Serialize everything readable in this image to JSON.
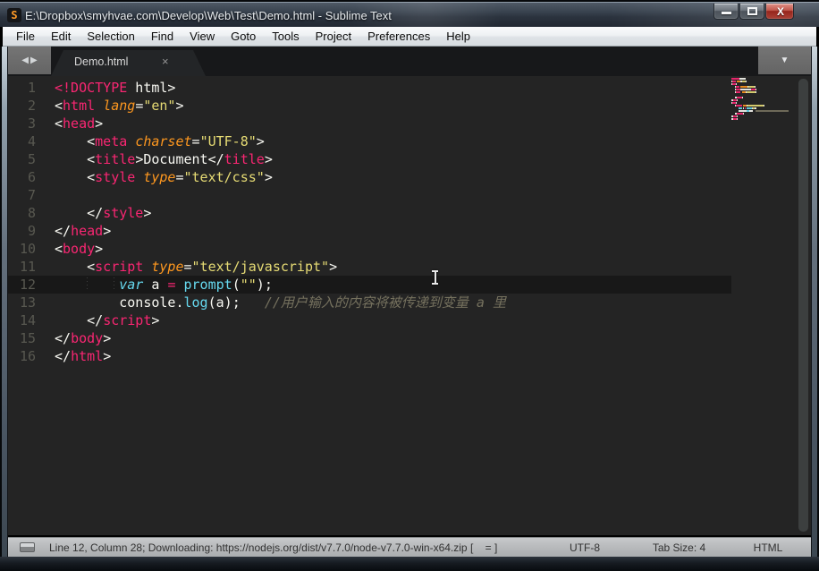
{
  "window": {
    "title": "E:\\Dropbox\\smyhvae.com\\Develop\\Web\\Test\\Demo.html - Sublime Text",
    "logo_letter": "S",
    "controls": {
      "minimize": "minimize",
      "maximize": "maximize",
      "close": "x"
    }
  },
  "menu": {
    "items": [
      "File",
      "Edit",
      "Selection",
      "Find",
      "View",
      "Goto",
      "Tools",
      "Project",
      "Preferences",
      "Help"
    ]
  },
  "tabbar": {
    "nav_left": "◀",
    "nav_right": "▶",
    "tab_label": "Demo.html",
    "close_glyph": "×",
    "overflow_glyph": "▼"
  },
  "editor": {
    "current_line": 12,
    "colors": {
      "background": "#242424",
      "current_line_band": "#181818",
      "line_number": "#585850",
      "tag": "#f92672",
      "punct": "#f8f8f2",
      "attr": "#fd971f",
      "str": "#e6db74",
      "kw": "#66d9ef",
      "fn": "#66d9ef",
      "op": "#f92672",
      "txt": "#f8f8f2",
      "comment": "#75715e",
      "plain": "#f8f8f2"
    },
    "italic_token_types": [
      "attr",
      "kw",
      "comment"
    ],
    "lines": [
      {
        "n": 1,
        "tokens": [
          [
            "<!DOCTYPE",
            "tag"
          ],
          [
            " html>",
            "punct"
          ]
        ]
      },
      {
        "n": 2,
        "tokens": [
          [
            "<",
            "punct"
          ],
          [
            "html",
            "tag"
          ],
          [
            " ",
            "plain"
          ],
          [
            "lang",
            "attr"
          ],
          [
            "=",
            "punct"
          ],
          [
            "\"en\"",
            "str"
          ],
          [
            ">",
            "punct"
          ]
        ]
      },
      {
        "n": 3,
        "tokens": [
          [
            "<",
            "punct"
          ],
          [
            "head",
            "tag"
          ],
          [
            ">",
            "punct"
          ]
        ]
      },
      {
        "n": 4,
        "tokens": [
          [
            "    ",
            "plain"
          ],
          [
            "<",
            "punct"
          ],
          [
            "meta",
            "tag"
          ],
          [
            " ",
            "plain"
          ],
          [
            "charset",
            "attr"
          ],
          [
            "=",
            "punct"
          ],
          [
            "\"UTF-8\"",
            "str"
          ],
          [
            ">",
            "punct"
          ]
        ]
      },
      {
        "n": 5,
        "tokens": [
          [
            "    ",
            "plain"
          ],
          [
            "<",
            "punct"
          ],
          [
            "title",
            "tag"
          ],
          [
            ">",
            "punct"
          ],
          [
            "Document",
            "txt"
          ],
          [
            "</",
            "punct"
          ],
          [
            "title",
            "tag"
          ],
          [
            ">",
            "punct"
          ]
        ]
      },
      {
        "n": 6,
        "tokens": [
          [
            "    ",
            "plain"
          ],
          [
            "<",
            "punct"
          ],
          [
            "style",
            "tag"
          ],
          [
            " ",
            "plain"
          ],
          [
            "type",
            "attr"
          ],
          [
            "=",
            "punct"
          ],
          [
            "\"text/css\"",
            "str"
          ],
          [
            ">",
            "punct"
          ]
        ]
      },
      {
        "n": 7,
        "tokens": []
      },
      {
        "n": 8,
        "tokens": [
          [
            "    ",
            "plain"
          ],
          [
            "</",
            "punct"
          ],
          [
            "style",
            "tag"
          ],
          [
            ">",
            "punct"
          ]
        ]
      },
      {
        "n": 9,
        "tokens": [
          [
            "</",
            "punct"
          ],
          [
            "head",
            "tag"
          ],
          [
            ">",
            "punct"
          ]
        ]
      },
      {
        "n": 10,
        "tokens": [
          [
            "<",
            "punct"
          ],
          [
            "body",
            "tag"
          ],
          [
            ">",
            "punct"
          ]
        ]
      },
      {
        "n": 11,
        "tokens": [
          [
            "    ",
            "plain"
          ],
          [
            "<",
            "punct"
          ],
          [
            "script",
            "tag"
          ],
          [
            " ",
            "plain"
          ],
          [
            "type",
            "attr"
          ],
          [
            "=",
            "punct"
          ],
          [
            "\"text/javascript\"",
            "str"
          ],
          [
            ">",
            "punct"
          ]
        ]
      },
      {
        "n": 12,
        "tokens": [
          [
            "        ",
            "plain"
          ],
          [
            "var",
            "kw"
          ],
          [
            " ",
            "plain"
          ],
          [
            "a",
            "txt"
          ],
          [
            " ",
            "plain"
          ],
          [
            "=",
            "op"
          ],
          [
            " ",
            "plain"
          ],
          [
            "prompt",
            "fn"
          ],
          [
            "(",
            "punct"
          ],
          [
            "\"\"",
            "str"
          ],
          [
            ")",
            "punct"
          ],
          [
            ";",
            "punct"
          ]
        ]
      },
      {
        "n": 13,
        "tokens": [
          [
            "        ",
            "plain"
          ],
          [
            "console",
            "txt"
          ],
          [
            ".",
            "punct"
          ],
          [
            "log",
            "fn"
          ],
          [
            "(",
            "punct"
          ],
          [
            "a",
            "txt"
          ],
          [
            ")",
            "punct"
          ],
          [
            ";",
            "punct"
          ],
          [
            "   ",
            "plain"
          ],
          [
            "//用户输入的内容将被传递到变量 a 里",
            "comment"
          ]
        ]
      },
      {
        "n": 14,
        "tokens": [
          [
            "    ",
            "plain"
          ],
          [
            "</",
            "punct"
          ],
          [
            "script",
            "tag"
          ],
          [
            ">",
            "punct"
          ]
        ]
      },
      {
        "n": 15,
        "tokens": [
          [
            "</",
            "punct"
          ],
          [
            "body",
            "tag"
          ],
          [
            ">",
            "punct"
          ]
        ]
      },
      {
        "n": 16,
        "tokens": [
          [
            "</",
            "punct"
          ],
          [
            "html",
            "tag"
          ],
          [
            ">",
            "punct"
          ]
        ]
      }
    ]
  },
  "statusbar": {
    "left_text": "Line 12, Column 28; Downloading: https://nodejs.org/dist/v7.7.0/node-v7.7.0-win-x64.zip [    = ]",
    "encoding": "UTF-8",
    "tab_size": "Tab Size: 4",
    "syntax": "HTML"
  }
}
